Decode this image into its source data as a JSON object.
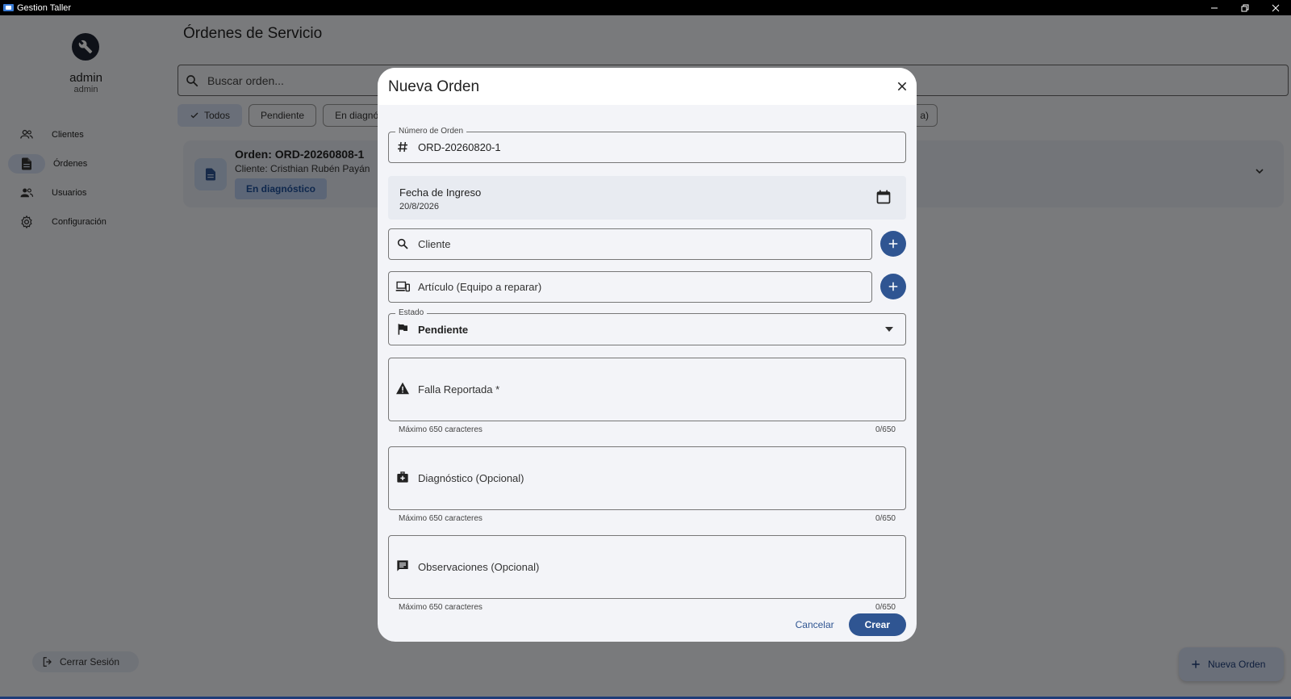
{
  "window": {
    "title": "Gestion Taller",
    "controls": [
      "minimize",
      "restore",
      "close"
    ]
  },
  "sidebar": {
    "user_name": "admin",
    "user_role": "admin",
    "items": [
      {
        "label": "Clientes",
        "icon": "people-icon"
      },
      {
        "label": "Órdenes",
        "icon": "document-icon",
        "active": true
      },
      {
        "label": "Usuarios",
        "icon": "group-icon"
      },
      {
        "label": "Configuración",
        "icon": "gear-icon"
      }
    ],
    "logout_label": "Cerrar Sesión"
  },
  "main": {
    "title": "Órdenes de Servicio",
    "search_placeholder": "Buscar orden...",
    "filters": [
      "Todos",
      "Pendiente",
      "En diagnó"
    ],
    "filter_partial_right": "a)",
    "order": {
      "title": "Orden: ORD-20260808-1",
      "client": "Cliente: Cristhian Rubén Payán",
      "status": "En diagnóstico"
    },
    "fab_label": "Nueva Orden"
  },
  "dialog": {
    "title": "Nueva Orden",
    "order_number_label": "Número de Orden",
    "order_number_value": "ORD-20260820-1",
    "date_label": "Fecha de Ingreso",
    "date_value": "20/8/2026",
    "client_placeholder": "Cliente",
    "article_placeholder": "Artículo (Equipo a reparar)",
    "status_label": "Estado",
    "status_value": "Pendiente",
    "fault_placeholder": "Falla Reportada *",
    "diagnosis_placeholder": "Diagnóstico (Opcional)",
    "notes_placeholder": "Observaciones (Opcional)",
    "helper_text": "Máximo 650 caracteres",
    "fault_counter": "0/650",
    "diagnosis_counter": "0/650",
    "notes_counter": "0/650",
    "cancel_label": "Cancelar",
    "create_label": "Crear"
  },
  "colors": {
    "primary": "#2f5592",
    "app_background": "#f3f4f8",
    "chip_selected": "#d4dff2",
    "badge_background": "#b9cdee",
    "badge_text": "#1d4f9a"
  }
}
